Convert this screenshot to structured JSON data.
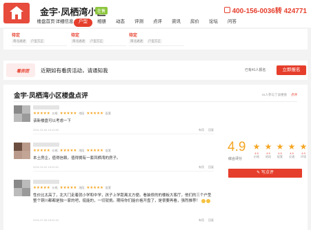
{
  "header": {
    "title": "金宇·凤栖湾小区",
    "sale_badge": "在售",
    "phone": "400-156-0036转 424771"
  },
  "nav": [
    "楼盘首页",
    "详细信息",
    "户型",
    "相册",
    "动态",
    "评测",
    "点评",
    "资讯",
    "房价",
    "论坛",
    "问答"
  ],
  "nav_active_index": 2,
  "strip": [
    {
      "status": "待定",
      "tags": [
        "南北通透",
        "户型方正"
      ]
    },
    {
      "status": "待定",
      "tags": [
        "南北通透",
        "户型方正"
      ]
    },
    {
      "status": "待定",
      "tags": [
        "南北通透",
        "户型方正"
      ]
    }
  ],
  "notice": {
    "tag": "看房团",
    "text": "近期如有看房活动，请通知我",
    "count": "已有41人报名",
    "button": "立即报名"
  },
  "reviews": {
    "title": "金宇·凤栖湾小区楼盘点评",
    "meta_count": "41人参与了该楼盘",
    "meta_link": "点评",
    "star_labels": [
      "价格",
      "地段",
      "配套",
      "交通",
      "环境"
    ],
    "items": [
      {
        "text": "该新楼盘可以考虑一下",
        "date": "2021-01-04 19:10:00",
        "actions": [
          "有用",
          "回复"
        ]
      },
      {
        "text": "本土房企，值得信赖。值得拥有一套凤栖湾的房子。",
        "date": "2021-01-02 19:20:01",
        "actions": [
          "有用",
          "回复"
        ]
      },
      {
        "text": "性价比太高了，北大门走着就小学和中学，孩子上学距离太方便。看装修的的楼板大客厅，他们的三个户型整个铜川都都是独一家的吧，挺能的，一切就挑。期待你们能价格开盘了，是很要再看，强烈推荐！",
        "date": "2021-07-08 15:02:41",
        "actions": [
          "有用",
          "回复"
        ]
      }
    ]
  },
  "score": {
    "value": "4.9",
    "label": "综合评分",
    "dims": [
      {
        "v": "4.9",
        "k": "价格"
      },
      {
        "v": "4.9",
        "k": "地段"
      },
      {
        "v": "4.9",
        "k": "配套"
      },
      {
        "v": "4.9",
        "k": "交通"
      },
      {
        "v": "4.9",
        "k": "环境"
      }
    ],
    "write_button": "写点评"
  }
}
